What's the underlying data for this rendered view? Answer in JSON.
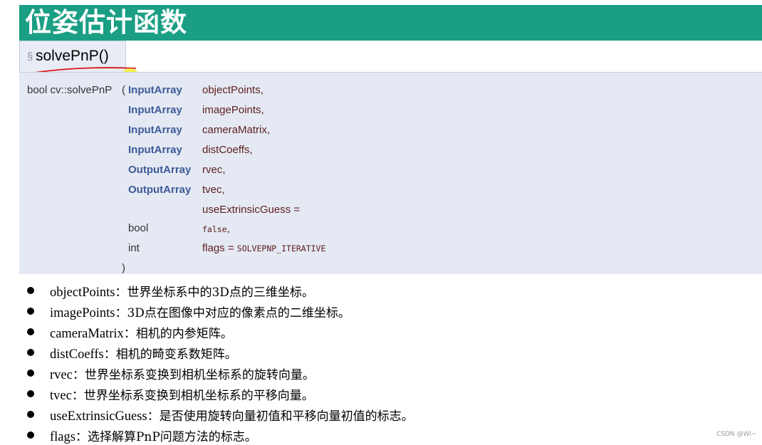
{
  "banner": {
    "title": "位姿估计函数",
    "color": "#1a9e84"
  },
  "tab": {
    "section_symbol": "§",
    "title": "solvePnP()"
  },
  "prototype": {
    "prefix": "bool cv::solvePnP",
    "open_paren": "(",
    "close_paren": ")",
    "params": [
      {
        "type": "InputArray",
        "name": "objectPoints,"
      },
      {
        "type": "InputArray",
        "name": "imagePoints,"
      },
      {
        "type": "InputArray",
        "name": "cameraMatrix,"
      },
      {
        "type": "InputArray",
        "name": "distCoeffs,"
      },
      {
        "type": "OutputArray",
        "name": "rvec,"
      },
      {
        "type": "OutputArray",
        "name": "tvec,"
      },
      {
        "type": "",
        "name": "useExtrinsicGuess ="
      },
      {
        "type": "bool",
        "name": "false",
        "suffix": ","
      },
      {
        "type": "int",
        "name": "flags = ",
        "default": "SOLVEPNP_ITERATIVE"
      }
    ]
  },
  "bullets": [
    {
      "name": "objectPoints",
      "desc": "：世界坐标系中的3D点的三维坐标。"
    },
    {
      "name": "imagePoints",
      "desc": "：3D点在图像中对应的像素点的二维坐标。"
    },
    {
      "name": "cameraMatrix",
      "desc": "：相机的内参矩阵。"
    },
    {
      "name": "distCoeffs",
      "desc": "：相机的畸变系数矩阵。"
    },
    {
      "name": "rvec",
      "desc": "：世界坐标系变换到相机坐标系的旋转向量。"
    },
    {
      "name": "tvec",
      "desc": "：世界坐标系变换到相机坐标系的平移向量。"
    },
    {
      "name": "useExtrinsicGuess",
      "desc": "：是否使用旋转向量初值和平移向量初值的标志。"
    },
    {
      "name": "flags",
      "desc": "：选择解算PnP问题方法的标志。"
    }
  ],
  "watermark": "CSDN @Wi~"
}
